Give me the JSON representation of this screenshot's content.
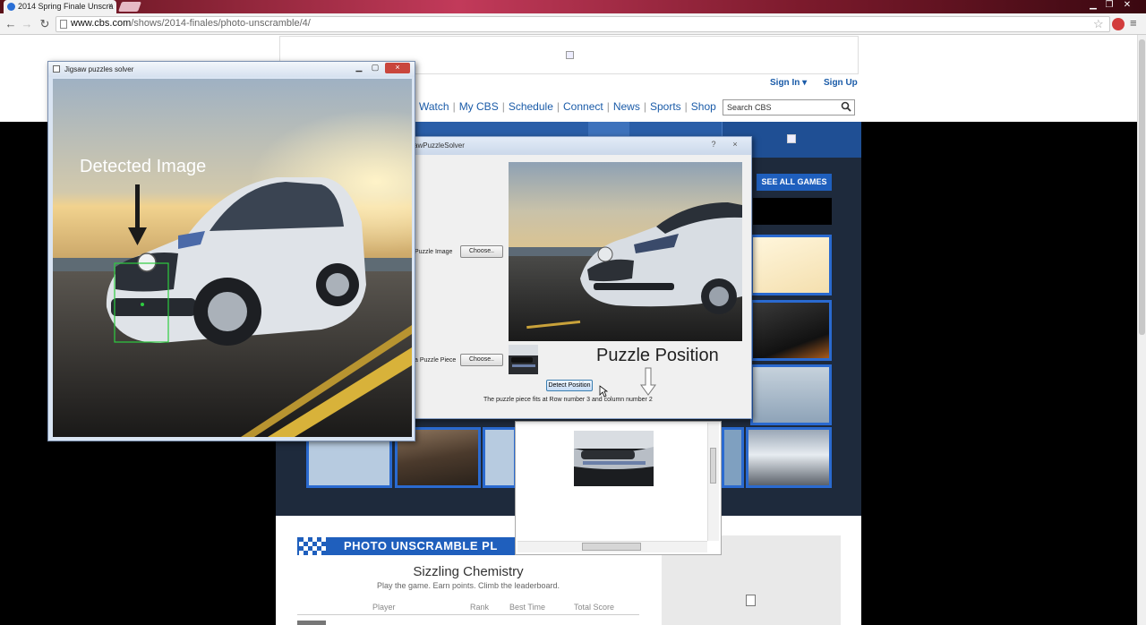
{
  "browser": {
    "tab_title": "2014 Spring Finale Unscra",
    "tab_close": "×",
    "url_domain": "www.cbs.com",
    "url_path": "/shows/2014-finales/photo-unscramble/4/"
  },
  "header": {
    "sign_in": "Sign In",
    "sign_up": "Sign Up",
    "nav": [
      "Watch",
      "My CBS",
      "Schedule",
      "Connect",
      "News",
      "Sports",
      "Shop"
    ],
    "search_placeholder": "Search CBS"
  },
  "game": {
    "see_all_games": "SEE ALL GAMES",
    "banner": "PHOTO UNSCRAMBLE PL",
    "title": "Sizzling Chemistry",
    "subtitle": "Play the game. Earn points. Climb the leaderboard.",
    "columns": [
      "Player",
      "Rank",
      "Best Time",
      "Total Score"
    ]
  },
  "solver": {
    "title": "awPuzzleSolver",
    "puzzle_image_label": "Puzzle Image",
    "puzzle_piece_label": "a Puzzle Piece",
    "choose_label": "Choose..",
    "puzzle_position_label": "Puzzle Position",
    "detect_button": "Detect Position",
    "result_text": "The puzzle piece fits at Row number  3 and column number  2",
    "help_btn": "?",
    "close_btn": "×"
  },
  "jigsaw": {
    "title": "Jigsaw puzzles solver",
    "detected_label": "Detected Image",
    "close_btn": "×"
  },
  "colors": {
    "cbs_blue": "#1f5fbd",
    "link_blue": "#1a5ba8",
    "detect_green": "#2ecc40"
  }
}
